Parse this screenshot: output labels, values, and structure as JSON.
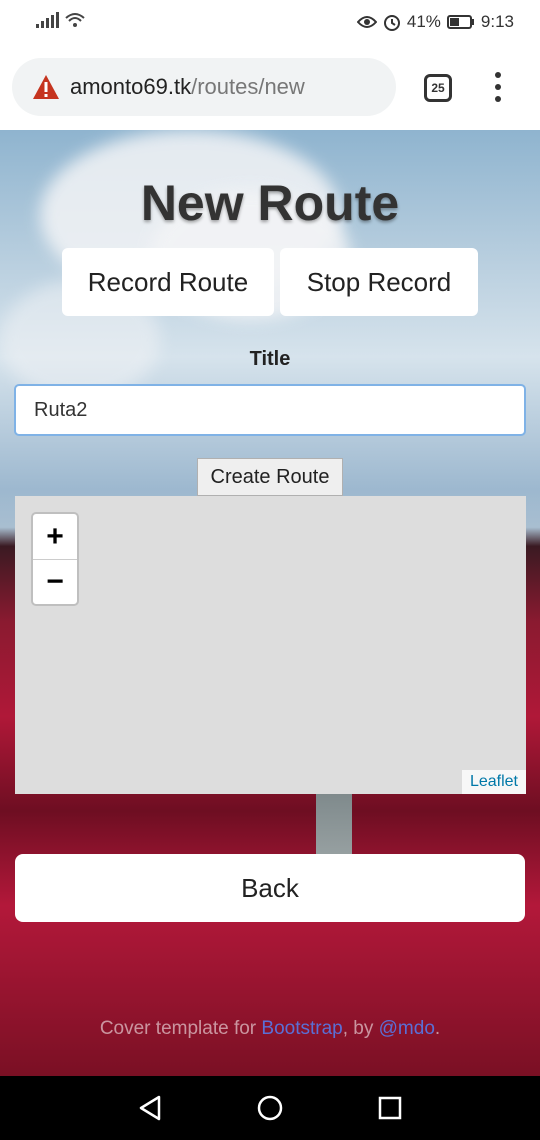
{
  "status_bar": {
    "battery": "41%",
    "time": "9:13"
  },
  "browser": {
    "url_domain": "amonto69.tk",
    "url_path": "/routes/new",
    "tab_count": "25"
  },
  "page": {
    "title": "New Route",
    "record_button": "Record Route",
    "stop_button": "Stop Record",
    "title_label": "Title",
    "title_input_value": "Ruta2",
    "create_button": "Create Route",
    "map": {
      "zoom_in": "+",
      "zoom_out": "−",
      "attribution": "Leaflet"
    },
    "back_button": "Back",
    "footer": {
      "prefix": "Cover template for ",
      "bootstrap": "Bootstrap",
      "by": ", by ",
      "author": "@mdo",
      "suffix": "."
    }
  },
  "colors": {
    "link": "#5a6fd6",
    "input_focus_border": "#7fb2e6",
    "leaflet_link": "#0078a8"
  },
  "icons": [
    "signal-icon",
    "wifi-icon",
    "eye-icon",
    "alarm-icon",
    "battery-icon",
    "warning-icon",
    "tab-switcher-icon",
    "overflow-menu-icon",
    "nav-back-icon",
    "nav-home-icon",
    "nav-recents-icon"
  ]
}
